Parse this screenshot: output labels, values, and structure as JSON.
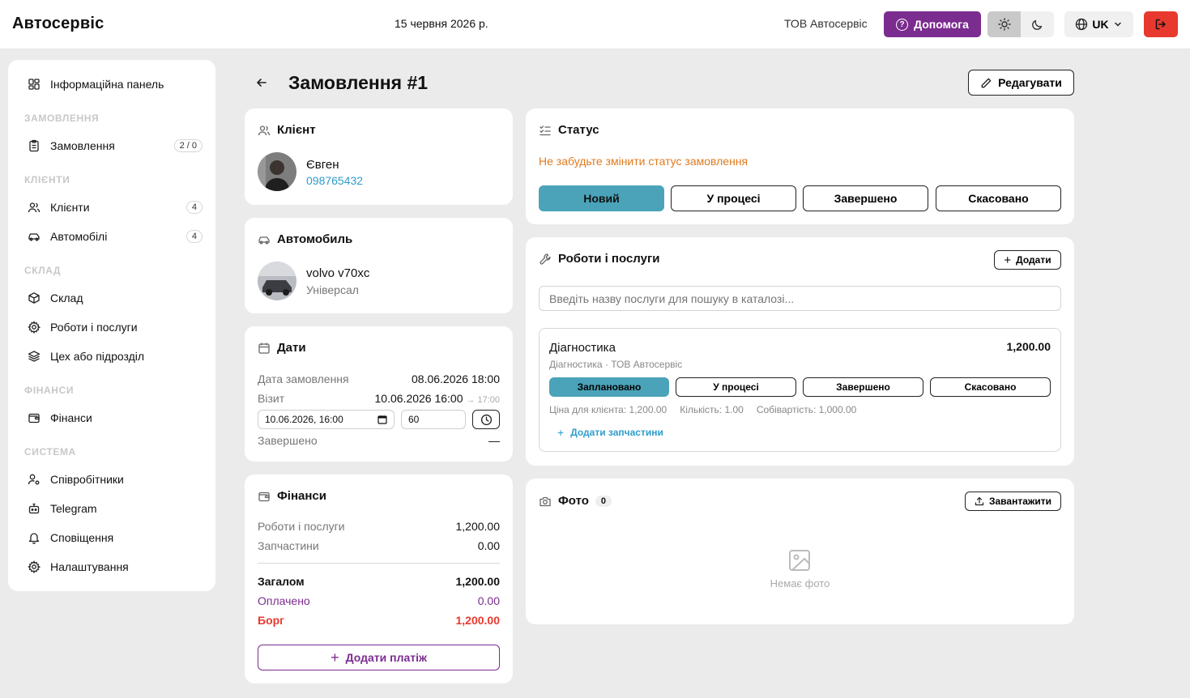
{
  "header": {
    "brand": "Автосервіс",
    "date": "15 червня 2026 р.",
    "company": "ТОВ Автосервіс",
    "help_label": "Допомога",
    "lang_label": "UK",
    "accent": "#7b2c8f",
    "logout_color": "#e8392f"
  },
  "sidebar": {
    "dashboard": "Інформаційна панель",
    "sections": {
      "orders": "ЗАМОВЛЕННЯ",
      "clients": "КЛІЄНТИ",
      "warehouse": "СКЛАД",
      "finance": "ФІНАНСИ",
      "system": "СИСТЕМА"
    },
    "items": {
      "orders": {
        "label": "Замовлення",
        "badge": "2 / 0"
      },
      "clients": {
        "label": "Клієнти",
        "badge": "4"
      },
      "cars": {
        "label": "Автомобілі",
        "badge": "4"
      },
      "warehouse": {
        "label": "Склад"
      },
      "services": {
        "label": "Роботи і послуги"
      },
      "workshop": {
        "label": "Цех або підрозділ"
      },
      "finance": {
        "label": "Фінанси"
      },
      "employees": {
        "label": "Співробітники"
      },
      "telegram": {
        "label": "Telegram"
      },
      "notifications": {
        "label": "Сповіщення"
      },
      "settings": {
        "label": "Налаштування"
      }
    }
  },
  "page": {
    "title": "Замовлення #1",
    "edit_label": "Редагувати"
  },
  "client": {
    "title": "Клієнт",
    "name": "Євген",
    "phone": "098765432"
  },
  "car": {
    "title": "Автомобиль",
    "model": "volvo v70xc",
    "body": "Універсал"
  },
  "dates": {
    "title": "Дати",
    "order_label": "Дата замовлення",
    "order_value": "08.06.2026 18:00",
    "visit_label": "Візит",
    "visit_value": "10.06.2026 16:00",
    "visit_end": "→ 17:00",
    "visit_input": "10.06.2026, 16:00",
    "duration_input": "60",
    "completed_label": "Завершено",
    "completed_value": "—"
  },
  "finance": {
    "title": "Фінанси",
    "services_label": "Роботи і послуги",
    "services_value": "1,200.00",
    "parts_label": "Запчастини",
    "parts_value": "0.00",
    "total_label": "Загалом",
    "total_value": "1,200.00",
    "paid_label": "Оплачено",
    "paid_value": "0.00",
    "debt_label": "Борг",
    "debt_value": "1,200.00",
    "add_payment": "Додати платіж",
    "paid_color": "#7b2c8f",
    "debt_color": "#e8392f"
  },
  "status": {
    "title": "Статус",
    "reminder": "Не забудьте змінити статус замовлення",
    "reminder_color": "#e07a1f",
    "options": [
      "Новий",
      "У процесі",
      "Завершено",
      "Скасовано"
    ],
    "active_color": "#4aa3b9"
  },
  "services": {
    "title": "Роботи і послуги",
    "add_label": "Додати",
    "search_placeholder": "Введіть назву послуги для пошуку в каталозі...",
    "item": {
      "name": "Діагностика",
      "price": "1,200.00",
      "subtitle": "Діагностика · ТОВ Автосервіс",
      "statuses": [
        "Заплановано",
        "У процесі",
        "Завершено",
        "Скасовано"
      ],
      "client_price": "Ціна для клієнта: 1,200.00",
      "quantity": "Кількість: 1.00",
      "cost": "Собівартість: 1,000.00",
      "add_parts": "Додати запчастини"
    }
  },
  "photos": {
    "title": "Фото",
    "count": "0",
    "upload_label": "Завантажити",
    "empty": "Немає фото"
  }
}
